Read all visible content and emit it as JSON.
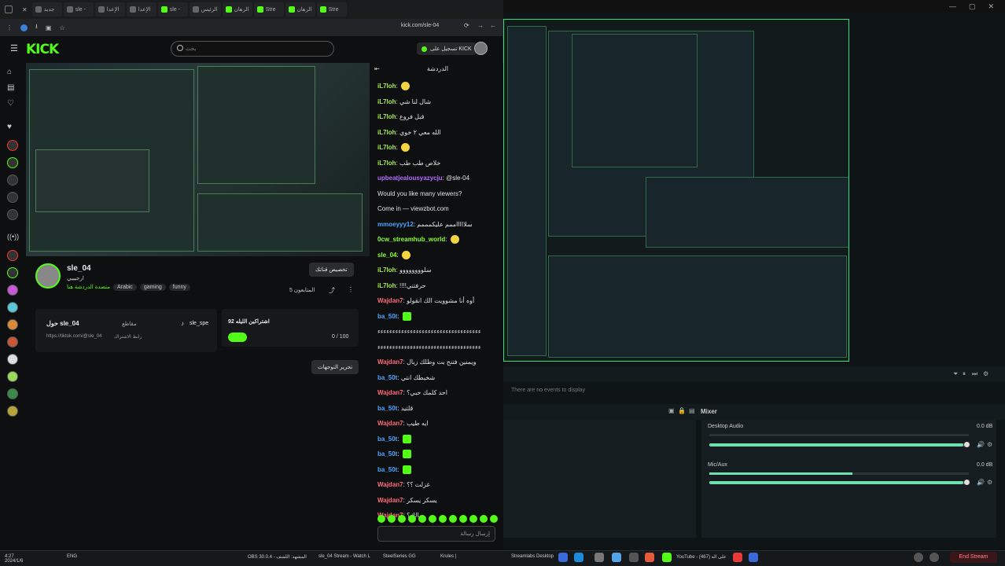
{
  "browser": {
    "tabs": [
      {
        "label": "جديد"
      },
      {
        "label": "sle -"
      },
      {
        "label": "الإعدا"
      },
      {
        "label": "الإعدا"
      },
      {
        "label": "sle -"
      },
      {
        "label": "الرئيس"
      },
      {
        "label": "الرهان"
      },
      {
        "label": "Stre"
      },
      {
        "label": "الرهان"
      },
      {
        "label": "Stre"
      }
    ],
    "url": "kick.com/sle-04"
  },
  "kick": {
    "logo": "KICK",
    "search_placeholder": "بحث",
    "login_label": "تسجيل على KICK",
    "chat_title": "الدردشة",
    "channel": {
      "name": "sle_04",
      "subtitle": "ارجيييي",
      "live_text": "متصدة الدردشة هنا",
      "tags": [
        "Arabic",
        "gaming",
        "funny"
      ],
      "customize_label": "تخصيص قناتك",
      "followers": "المتابعون 5",
      "edit_label": "تحرير التوجهات"
    },
    "card_about": {
      "title": "حول sle_04",
      "label": "مقاطع",
      "link": "https://tiktok.com/@sle_04",
      "url_label": "رابط الاشتراك"
    },
    "card_sub": {
      "title": "اشتراكين الليله 92",
      "counter": "0 / 100",
      "user": "sle_spe"
    },
    "chat_input_placeholder": "إرسال رسالة"
  },
  "chat": {
    "messages": [
      {
        "user": "iL7loh",
        "text": "",
        "color": "green"
      },
      {
        "user": "iL7loh",
        "text": "شال لنا شي",
        "color": "green"
      },
      {
        "user": "iL7loh",
        "text": "قبل فروع",
        "color": "green"
      },
      {
        "user": "iL7loh",
        "text": "الله معي ٢ خوي",
        "color": "green"
      },
      {
        "user": "iL7loh",
        "text": "",
        "color": "green"
      },
      {
        "user": "iL7loh",
        "text": "خلاص طب طب",
        "color": "green"
      },
      {
        "user": "upbeatjealousyazycju",
        "text": "@sle-04",
        "color": "purple"
      },
      {
        "user": "",
        "text": "Would you like many viewers?",
        "color": "plain"
      },
      {
        "user": "",
        "text": "Come in — viewzbot.com",
        "color": "plain"
      },
      {
        "user": "mmoeyyy12",
        "text": "سلاااااممم عليكمممم",
        "color": "blue"
      },
      {
        "user": "0cw_streamhub_world",
        "text": "",
        "color": "lime"
      },
      {
        "user": "sle_04",
        "text": "",
        "color": "lime"
      },
      {
        "user": "iL7loh",
        "text": "سلوووووووو",
        "color": "green"
      },
      {
        "user": "iL7loh",
        "text": "!!!!حرفتني",
        "color": "green"
      },
      {
        "user": "Wajdan7",
        "text": "أوه أنا مشوويت الك انقولو",
        "color": "red"
      },
      {
        "user": "ba_50t",
        "text": "",
        "color": "blue"
      },
      {
        "user": "",
        "text": "ءءءءءءءءءءءءءءءءءءءءءءءءءءءءءءءءءءء",
        "color": "plain"
      },
      {
        "user": "",
        "text": "ءءءءءءءءءءءءءءءءءءءءءءءءءءءءءءءءءءء",
        "color": "plain"
      },
      {
        "user": "Wajdan7",
        "text": "ويمنين فتنح بت وطلك زبال",
        "color": "red"
      },
      {
        "user": "ba_50t",
        "text": "شخبطك انتي",
        "color": "blue"
      },
      {
        "user": "Wajdan7",
        "text": "احد كلمك حبي؟",
        "color": "red"
      },
      {
        "user": "ba_50t",
        "text": "قلتيد",
        "color": "blue"
      },
      {
        "user": "Wajdan7",
        "text": "ايه طيب",
        "color": "red"
      },
      {
        "user": "ba_50t",
        "text": "",
        "color": "blue"
      },
      {
        "user": "ba_50t",
        "text": "",
        "color": "blue"
      },
      {
        "user": "ba_50t",
        "text": "",
        "color": "blue"
      },
      {
        "user": "Wajdan7",
        "text": "غزلت ؟؟",
        "color": "red"
      },
      {
        "user": "Wajdan7",
        "text": "يسكر يسكر",
        "color": "red"
      },
      {
        "user": "Wajdan7",
        "text": "مالك؟",
        "color": "red"
      }
    ]
  },
  "obs": {
    "events_text": "There are no events to display",
    "mixer_label": "Mixer",
    "channels": [
      {
        "name": "Desktop Audio",
        "db": "0.0 dB",
        "volume": 0.98
      },
      {
        "name": "Mic/Aux",
        "db": "0.0 dB",
        "volume": 0.98,
        "level": 0.55
      }
    ],
    "end_stream_label": "End Stream"
  },
  "taskbar": {
    "items": [
      "ENG",
      "OBS 30.0.4 - المشهد: اللشف",
      "sle_04 Stream - Watch L",
      "SteelSeries GG",
      "Krules |",
      "Streamlabs Desktop",
      "YouTube - على اله (467)"
    ],
    "clock": "4:27",
    "date": "2024/1/6"
  },
  "colors": {
    "accent": "#53fc18",
    "obs_accent": "#6fe0b0",
    "danger": "#ff8585"
  }
}
